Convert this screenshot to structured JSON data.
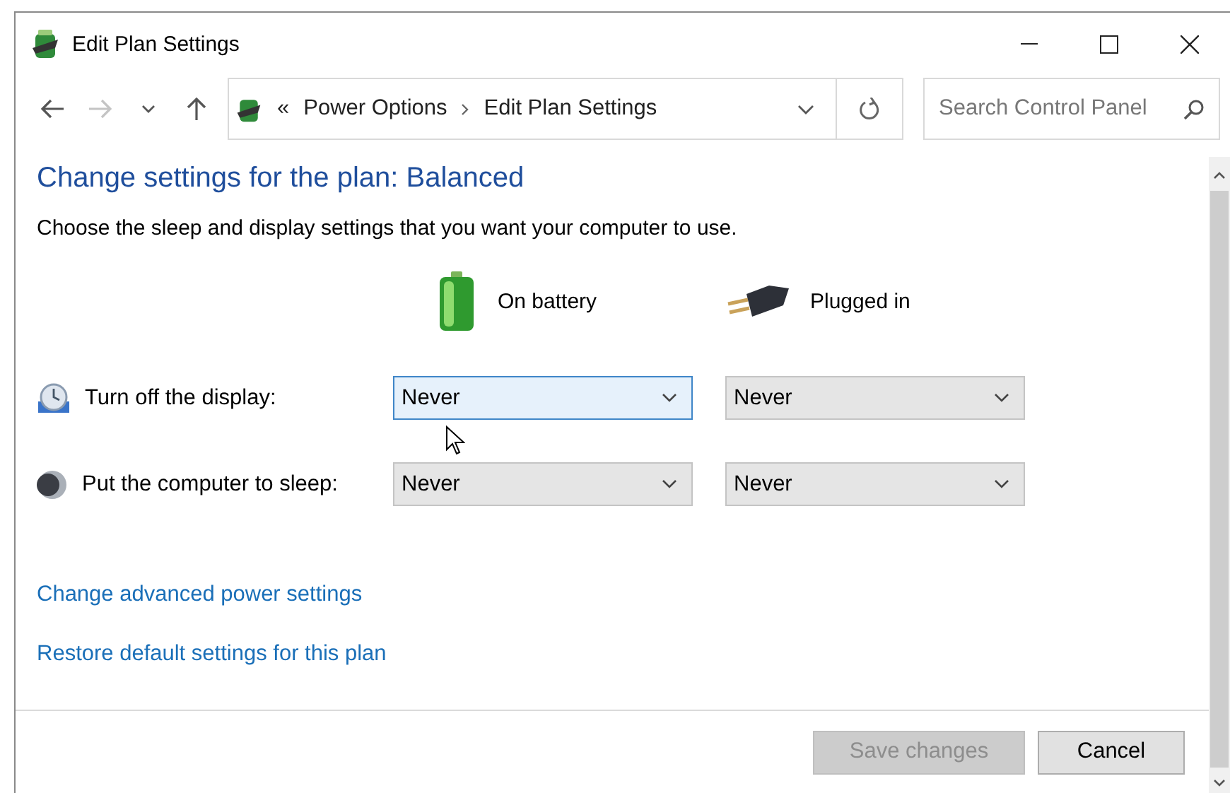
{
  "window": {
    "title": "Edit Plan Settings"
  },
  "nav_buttons": [
    {
      "kind": "back",
      "disabled": false
    },
    {
      "kind": "forward",
      "disabled": true
    },
    {
      "kind": "recent",
      "disabled": false
    },
    {
      "kind": "up",
      "disabled": false
    }
  ],
  "address": {
    "prefix": "«",
    "crumbs": [
      "Power Options",
      "Edit Plan Settings"
    ]
  },
  "search": {
    "placeholder": "Search Control Panel"
  },
  "heading": "Change settings for the plan: Balanced",
  "description": "Choose the sleep and display settings that you want your computer to use.",
  "columns": [
    {
      "kind": "battery",
      "label": "On battery"
    },
    {
      "kind": "plug",
      "label": "Plugged in"
    }
  ],
  "settings": [
    {
      "kind": "display",
      "label": "Turn off the display:",
      "values": [
        {
          "value": "Never",
          "focused": true
        },
        {
          "value": "Never",
          "focused": false
        }
      ]
    },
    {
      "kind": "sleep",
      "label": "Put the computer to sleep:",
      "values": [
        {
          "value": "Never",
          "focused": false
        },
        {
          "value": "Never",
          "focused": false
        }
      ]
    }
  ],
  "links": [
    "Change advanced power settings",
    "Restore default settings for this plan"
  ],
  "buttons": [
    {
      "label": "Save changes",
      "disabled": true
    },
    {
      "label": "Cancel",
      "disabled": false
    }
  ]
}
